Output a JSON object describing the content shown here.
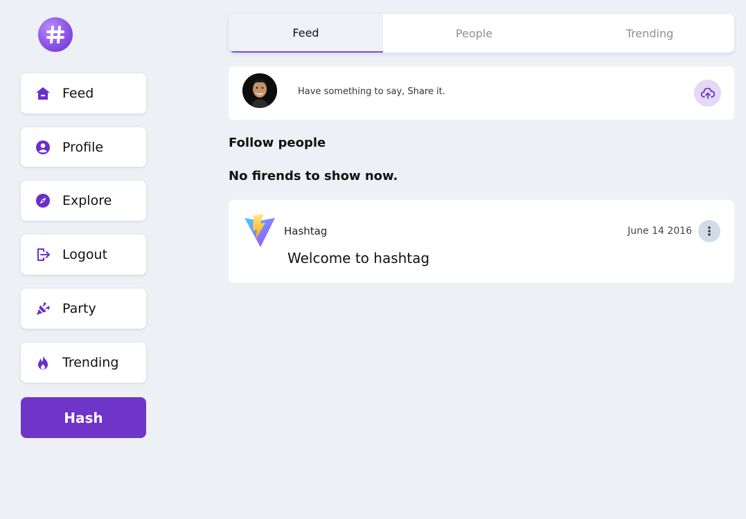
{
  "sidebar": {
    "logo_icon": "hashtag-icon",
    "items": [
      {
        "label": "Feed",
        "icon": "home-icon"
      },
      {
        "label": "Profile",
        "icon": "user-icon"
      },
      {
        "label": "Explore",
        "icon": "compass-icon"
      },
      {
        "label": "Logout",
        "icon": "logout-icon"
      },
      {
        "label": "Party",
        "icon": "party-popper-icon"
      },
      {
        "label": "Trending",
        "icon": "fire-icon"
      }
    ],
    "cta_label": "Hash"
  },
  "tabs": [
    {
      "label": "Feed",
      "active": true
    },
    {
      "label": "People",
      "active": false
    },
    {
      "label": "Trending",
      "active": false
    }
  ],
  "composer": {
    "prompt": "Have something to say, Share it.",
    "upload_icon": "cloud-upload-icon"
  },
  "sections": {
    "follow_heading": "Follow people",
    "empty_friends": "No firends to show now."
  },
  "post": {
    "author": "Hashtag",
    "date": "June 14 2016",
    "body": "Welcome to hashtag",
    "menu_icon": "more-vertical-icon"
  },
  "colors": {
    "accent": "#6f34c8",
    "background": "#edf1f6",
    "upload_bg": "#e3d8f6",
    "more_bg": "#d1dce6"
  }
}
